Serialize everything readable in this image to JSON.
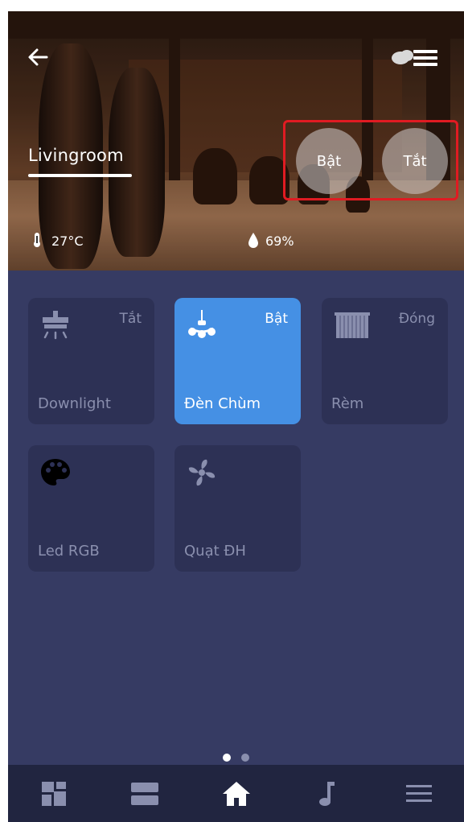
{
  "room": {
    "name": "Livingroom",
    "temperature": "27°C",
    "humidity": "69%"
  },
  "header": {
    "back_icon": "back-arrow-icon",
    "menu_icons": [
      "cloud-icon",
      "hamburger-menu-icon"
    ]
  },
  "quick_actions": {
    "on_label": "Bật",
    "off_label": "Tắt",
    "highlight_color": "#e01b22"
  },
  "devices": [
    {
      "name": "Downlight",
      "state": "Tắt",
      "icon": "downlight-icon",
      "active": false
    },
    {
      "name": "Đèn Chùm",
      "state": "Bật",
      "icon": "chandelier-icon",
      "active": true
    },
    {
      "name": "Rèm",
      "state": "Đóng",
      "icon": "curtain-icon",
      "active": false
    },
    {
      "name": "Led RGB",
      "state": "",
      "icon": "palette-icon",
      "active": false
    },
    {
      "name": "Quạt ĐH",
      "state": "",
      "icon": "fan-icon",
      "active": false
    }
  ],
  "pager": {
    "count": 2,
    "current": 1
  },
  "bottom_nav": [
    {
      "icon": "dashboard-icon",
      "active": false
    },
    {
      "icon": "rooms-icon",
      "active": false
    },
    {
      "icon": "home-icon",
      "active": true
    },
    {
      "icon": "music-icon",
      "active": false
    },
    {
      "icon": "menu-icon",
      "active": false
    }
  ],
  "colors": {
    "background": "#363b63",
    "tile": "#2d3155",
    "tile_active": "#4590e4",
    "tile_text": "#8a8fae",
    "nav_bar": "#212540"
  }
}
